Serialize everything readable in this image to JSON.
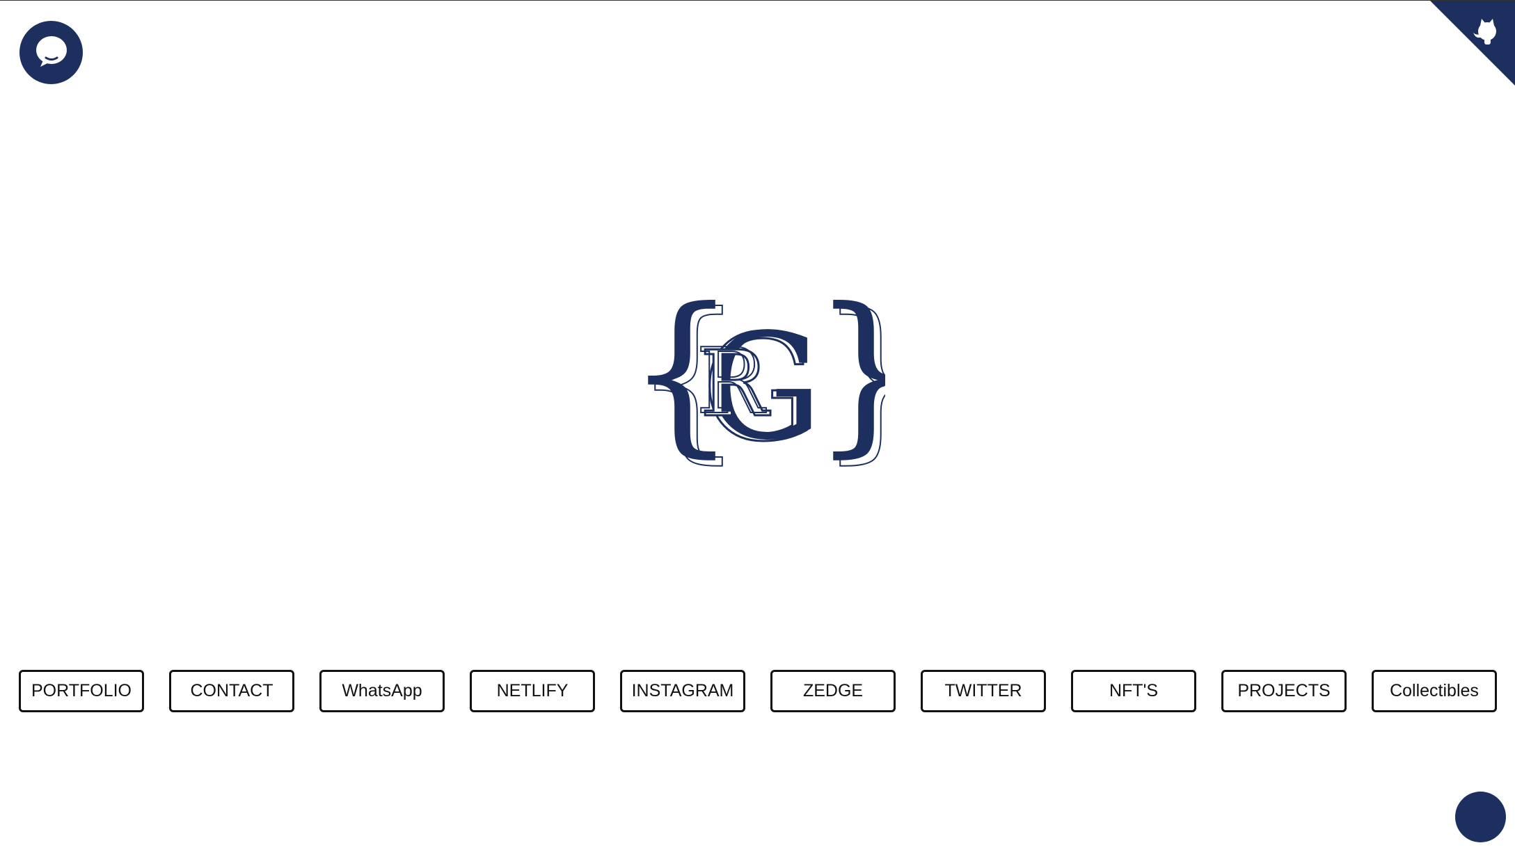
{
  "theme": {
    "brand_color": "#1c2f5e",
    "background": "#ffffff"
  },
  "header": {
    "chat_icon": "chat-bubble-icon",
    "corner_icon": "github-octocat-icon"
  },
  "logo": {
    "monogram": "RG",
    "brackets": "{}"
  },
  "nav": {
    "items": [
      {
        "label": "PORTFOLIO"
      },
      {
        "label": "CONTACT"
      },
      {
        "label": "WhatsApp"
      },
      {
        "label": "NETLIFY"
      },
      {
        "label": "INSTAGRAM"
      },
      {
        "label": "ZEDGE"
      },
      {
        "label": "TWITTER"
      },
      {
        "label": "NFT'S"
      },
      {
        "label": "PROJECTS"
      },
      {
        "label": "Collectibles"
      }
    ]
  },
  "floating_button": {
    "icon": "circle-button-icon"
  }
}
